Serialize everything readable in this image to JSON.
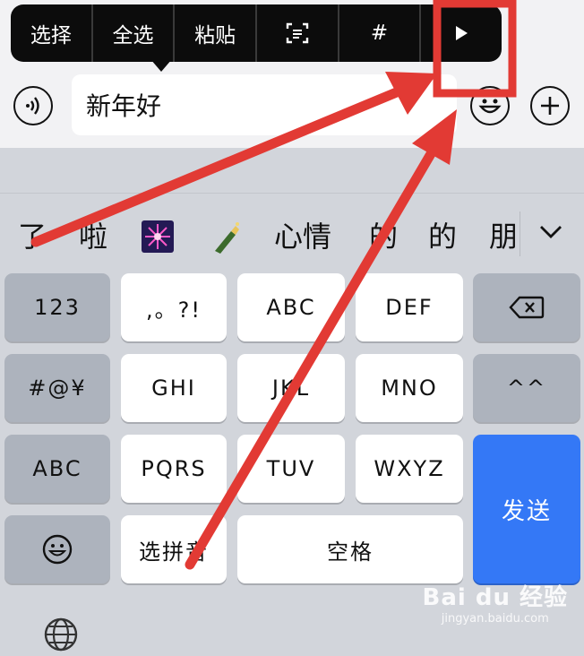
{
  "context_menu": {
    "items": [
      "选择",
      "全选",
      "粘贴",
      "",
      "#",
      ""
    ]
  },
  "input": {
    "value": "新年好"
  },
  "candidates": [
    "了",
    "啦",
    "",
    "",
    "心情",
    "的",
    "的",
    "朋"
  ],
  "keyboard": {
    "row1": [
      "123",
      ",。?!",
      "ABC",
      "DEF",
      ""
    ],
    "row2": [
      "#@¥",
      "GHI",
      "JKL",
      "MNO",
      "^^"
    ],
    "row3": [
      "ABC",
      "PQRS",
      "TUV",
      "WXYZ"
    ],
    "row4": [
      "",
      "选拼音",
      "空格"
    ],
    "send": "发送"
  },
  "watermark": {
    "main": "Bai du 经验",
    "sub": "jingyan.baidu.com"
  },
  "colors": {
    "annotation_red": "#e23a34",
    "send_blue": "#3478f6"
  },
  "icons": [
    "voice-icon",
    "scan-text-icon",
    "play-icon",
    "emoji-icon",
    "plus-icon",
    "chevron-down-icon",
    "backspace-icon",
    "emoji-key-icon",
    "globe-icon",
    "fireworks-emoji",
    "champagne-emoji"
  ]
}
